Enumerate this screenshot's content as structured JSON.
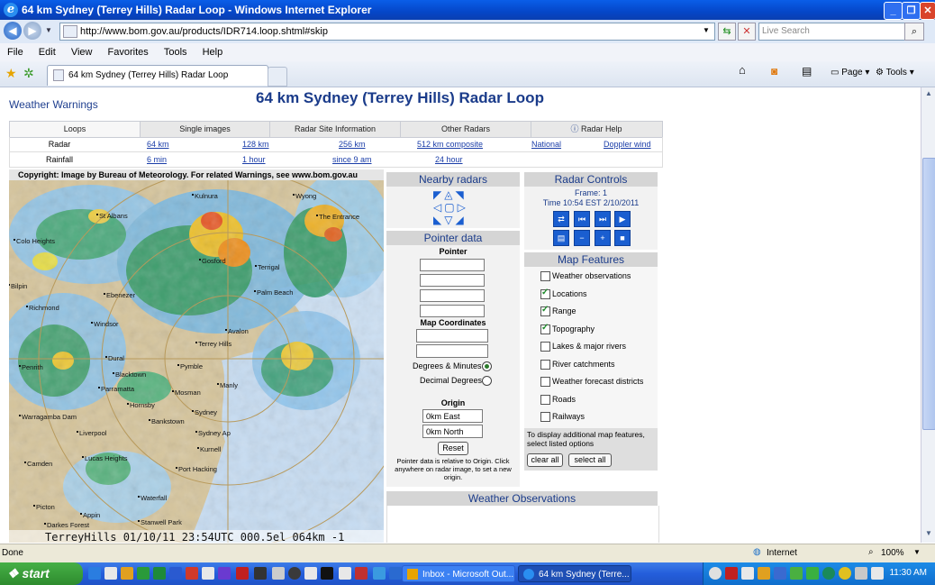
{
  "window": {
    "title": "64 km Sydney (Terrey Hills) Radar Loop - Windows Internet Explorer",
    "controls": [
      "_",
      "❐",
      "✕"
    ]
  },
  "browser": {
    "url": "http://www.bom.gov.au/products/IDR714.loop.shtml#skip",
    "search_placeholder": "Live Search",
    "menu": [
      "File",
      "Edit",
      "View",
      "Favorites",
      "Tools",
      "Help"
    ],
    "tab_title": "64 km Sydney (Terrey Hills) Radar Loop",
    "toolbar": {
      "page": "Page",
      "tools": "Tools"
    }
  },
  "page": {
    "warnings_link": "Weather Warnings",
    "title": "64 km Sydney (Terrey Hills) Radar Loop",
    "tabs": [
      "Loops",
      "Single images",
      "Radar Site Information",
      "Other Radars",
      "Radar Help"
    ],
    "radar_row": {
      "label": "Radar",
      "links": [
        "64 km",
        "128 km",
        "256 km",
        "512 km composite",
        "National",
        "Doppler wind"
      ]
    },
    "rainfall_row": {
      "label": "Rainfall",
      "links": [
        "6 min",
        "1 hour",
        "since 9 am",
        "24 hour"
      ]
    },
    "copyright": "Copyright: Image by Bureau of Meteorology. For related Warnings, see www.bom.gov.au",
    "radar_footer": "TerreyHills 01/10/11 23:54UTC 000.5el 064km -1",
    "places": [
      "Kulnura",
      "St Albans",
      "Wyong",
      "The Entrance",
      "Colo Heights",
      "Gosford",
      "Terrigal",
      "Palm Beach",
      "Ebenezer",
      "Bilpin",
      "Windsor",
      "Avalon",
      "Richmond",
      "Terrey Hills",
      "Penrith",
      "Dural",
      "Pymble",
      "Blacktown",
      "Manly",
      "Parramatta",
      "Mosman",
      "Sydney",
      "Hornsby",
      "Bankstown",
      "Liverpool",
      "Warragamba Dam",
      "Sydney Ap",
      "Kurnell",
      "Camden",
      "Lucas Heights",
      "Port Hacking",
      "Waterfall",
      "Picton",
      "Appin",
      "Darkes Forest",
      "Stanwell Park"
    ],
    "nearby": {
      "title": "Nearby radars"
    },
    "pointer": {
      "title": "Pointer data",
      "pointer_label": "Pointer",
      "map_coords_label": "Map Coordinates",
      "deg_min": "Degrees & Minutes",
      "dec_deg": "Decimal Degrees",
      "origin_label": "Origin",
      "origin_east": "0km East",
      "origin_north": "0km North",
      "reset": "Reset",
      "note": "Pointer data is relative to Origin. Click anywhere on radar image, to set a new origin."
    },
    "controls": {
      "title": "Radar Controls",
      "frame": "Frame: 1",
      "time": "Time 10:54 EST 2/10/2011"
    },
    "features": {
      "title": "Map Features",
      "items": [
        {
          "label": "Weather observations",
          "checked": false
        },
        {
          "label": "Locations",
          "checked": true
        },
        {
          "label": "Range",
          "checked": true
        },
        {
          "label": "Topography",
          "checked": true
        },
        {
          "label": "Lakes & major rivers",
          "checked": false
        },
        {
          "label": "River catchments",
          "checked": false
        },
        {
          "label": "Weather forecast districts",
          "checked": false
        },
        {
          "label": "Roads",
          "checked": false
        },
        {
          "label": "Railways",
          "checked": false
        }
      ],
      "note": "To display additional map features, select listed options",
      "clear_all": "clear all",
      "select_all": "select all"
    },
    "observations": {
      "title": "Weather Observations"
    }
  },
  "status": {
    "left": "Done",
    "zone": "Internet",
    "zoom": "100%"
  },
  "taskbar": {
    "start": "start",
    "tasks": [
      "Inbox - Microsoft Out...",
      "64 km Sydney (Terre..."
    ],
    "clock": "11:30 AM"
  }
}
